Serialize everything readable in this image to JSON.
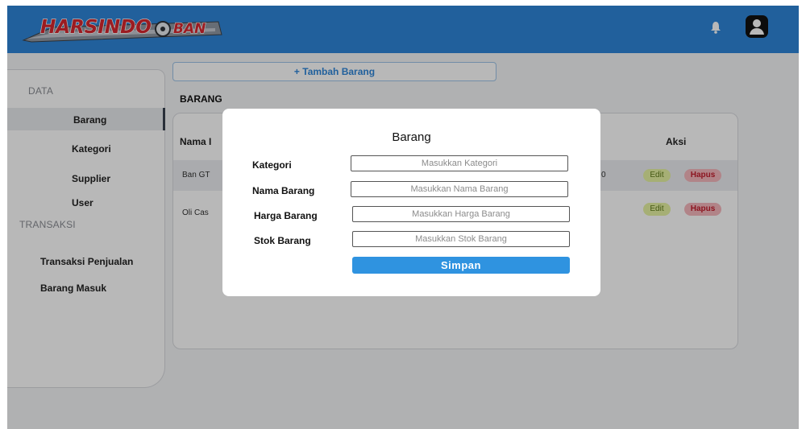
{
  "header": {
    "logo_text_1": "HARSINDO",
    "logo_text_2": "BAN",
    "brand_color": "#2f86d8",
    "icons": [
      "bell-icon",
      "user-icon"
    ]
  },
  "sidebar": {
    "data_label": "DATA",
    "items": [
      {
        "label": "Barang",
        "active": true
      },
      {
        "label": "Kategori"
      },
      {
        "label": "Supplier"
      },
      {
        "label": "User"
      }
    ],
    "transaksi_label": "TRANSAKSI",
    "transaksi_items": [
      {
        "label": "Transaksi Penjualan"
      },
      {
        "label": "Barang Masuk"
      }
    ]
  },
  "main": {
    "add_button": "+ Tambah Barang",
    "title": "BARANG",
    "table": {
      "headers": [
        "Nama I",
        "Aksi"
      ],
      "rows": [
        {
          "name": "Ban GT",
          "hidden_cell": "0",
          "edit": "Edit",
          "delete": "Hapus"
        },
        {
          "name": "Oli Cas",
          "edit": "Edit",
          "delete": "Hapus"
        }
      ]
    }
  },
  "modal": {
    "title": "Barang",
    "fields": [
      {
        "label": "Kategori",
        "placeholder": "Masukkan Kategori",
        "value": ""
      },
      {
        "label": "Nama Barang",
        "placeholder": "Masukkan Nama Barang",
        "value": ""
      },
      {
        "label": "Harga Barang",
        "placeholder": "Masukkan Harga Barang",
        "value": ""
      },
      {
        "label": "Stok Barang",
        "placeholder": "Masukkan Stok Barang",
        "value": ""
      }
    ],
    "save_label": "Simpan",
    "colors": {
      "button": "#2f93e0",
      "edit_badge": "#e6f3a3",
      "delete_badge": "#f6b7bd"
    }
  }
}
